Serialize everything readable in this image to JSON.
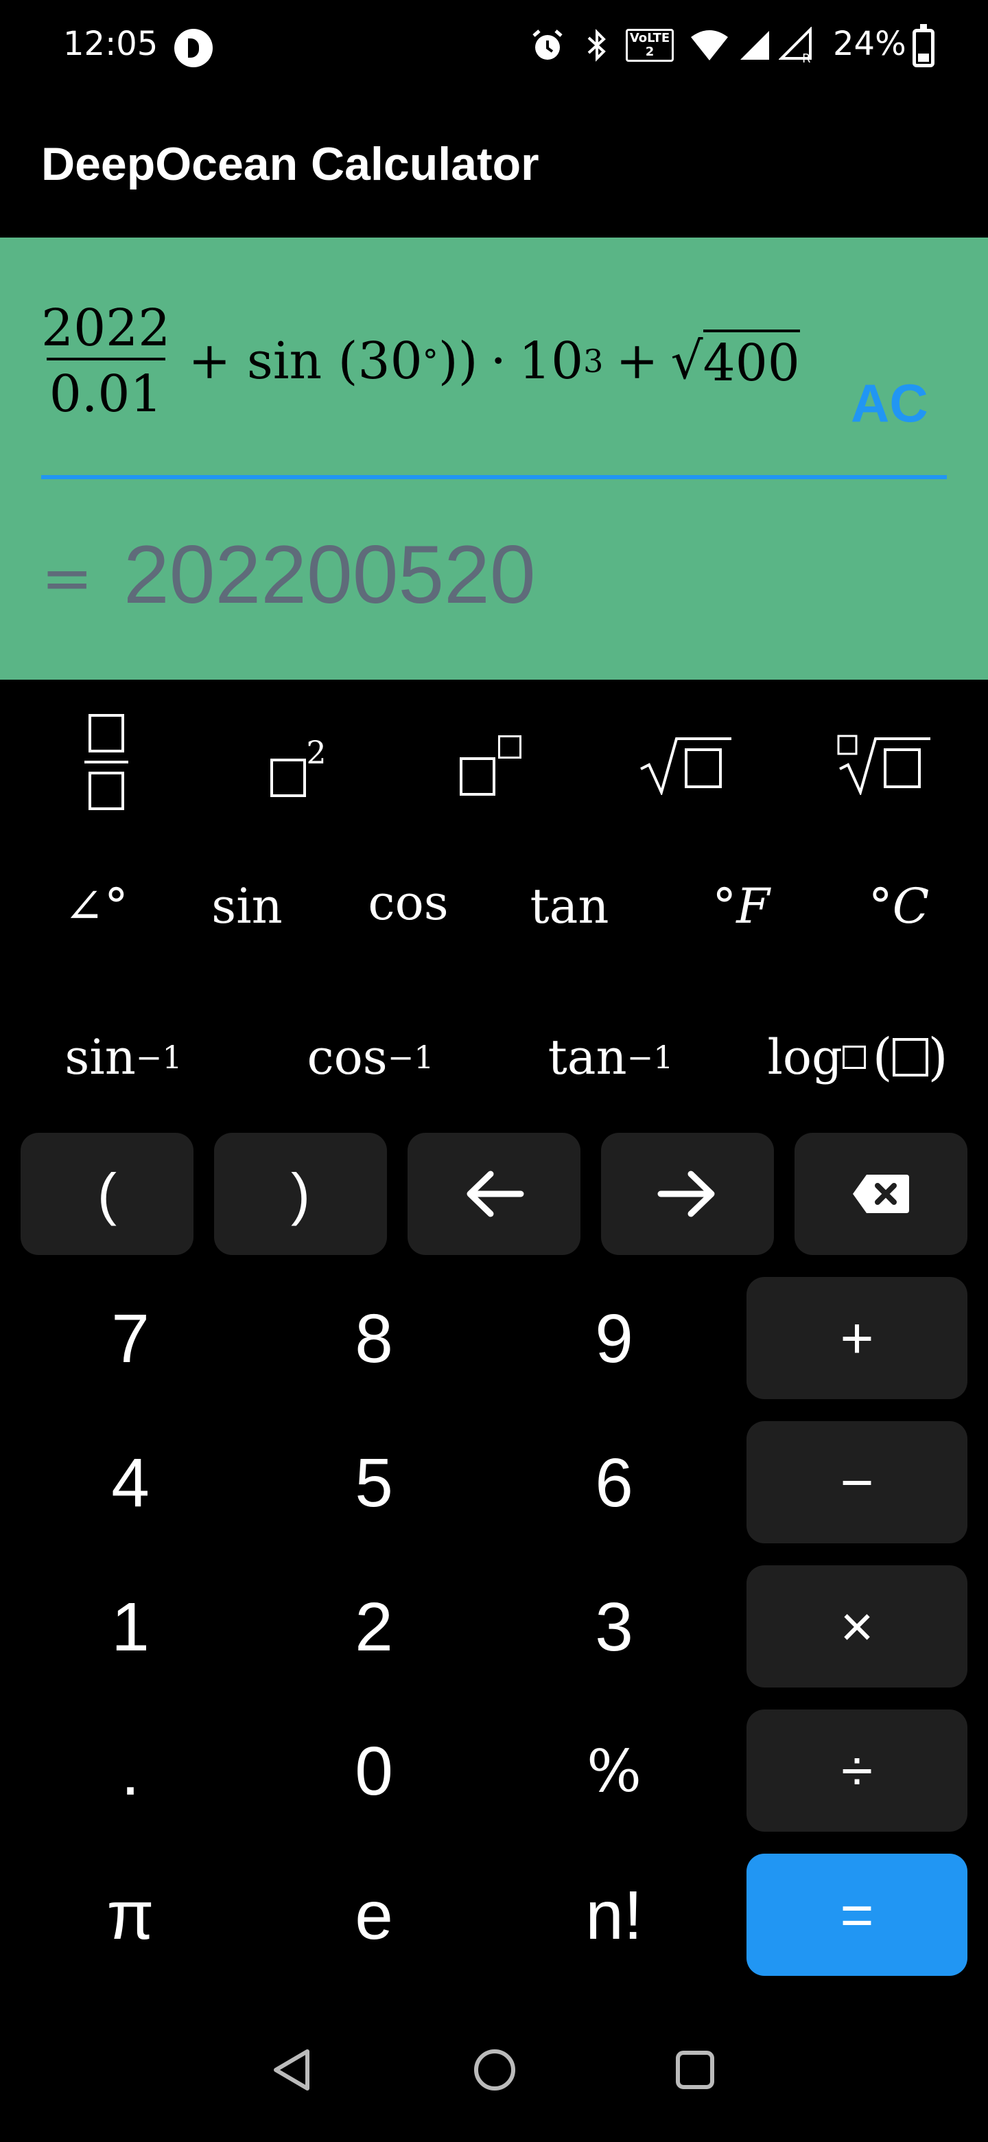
{
  "status_bar": {
    "time": "12:05",
    "battery": "24%",
    "icons": [
      "app-notification-icon",
      "alarm-icon",
      "bluetooth-icon",
      "volte-icon",
      "wifi-icon",
      "signal-icon",
      "signal-roaming-icon",
      "battery-charging-icon"
    ],
    "volte_label": "VoLTE 2"
  },
  "app_bar": {
    "title": "DeepOcean Calculator"
  },
  "display": {
    "expression": {
      "frac_num": "2022",
      "frac_den": "0.01",
      "part1": "+ sin (30",
      "degree": "°",
      "part2": "))",
      "dot": "·",
      "ten": "10",
      "exp": "3",
      "plus": "+",
      "sqrt_sign": "√",
      "sqrt_arg": "400"
    },
    "clear_label": "AC",
    "equals": "=",
    "result": "202200520",
    "accent_color": "#5ab586",
    "underline_color": "#2196f3"
  },
  "functions": {
    "row1": [
      "fraction-template-icon",
      "square-template-icon",
      "power-template-icon",
      "sqrt-template-icon",
      "nth-root-template-icon"
    ],
    "square_exp": "2",
    "row2": {
      "angle": "∠°",
      "sin": "sin",
      "cos": "cos",
      "tan": "tan",
      "fahrenheit": "°F",
      "celsius": "°C"
    },
    "row3": {
      "asin": "sin",
      "acos": "cos",
      "atan": "tan",
      "inv_exp": "−1",
      "log": "log"
    }
  },
  "keypad": {
    "nav_row": {
      "open_paren": "(",
      "close_paren": ")",
      "icons": [
        "arrow-left-icon",
        "arrow-right-icon",
        "backspace-icon"
      ]
    },
    "digits": [
      "7",
      "8",
      "9",
      "4",
      "5",
      "6",
      "1",
      "2",
      "3",
      ".",
      "0",
      "%",
      "π",
      "e",
      "n!"
    ],
    "operators": {
      "plus": "+",
      "minus": "−",
      "times": "×",
      "divide": "÷",
      "equals": "="
    },
    "equals_color": "#2196f3",
    "key_color": "#1f1f1f"
  },
  "nav_bar": {
    "icons": [
      "back-icon",
      "home-icon",
      "recents-icon"
    ]
  }
}
